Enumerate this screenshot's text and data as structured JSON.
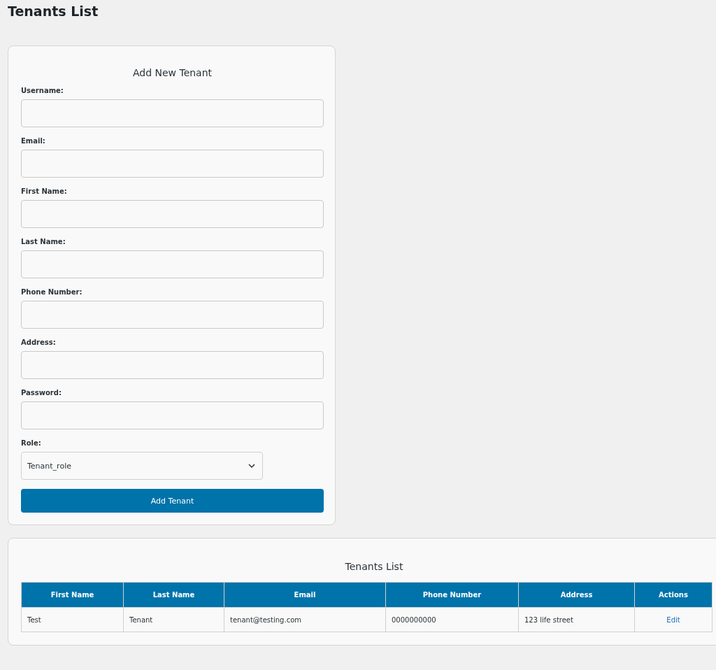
{
  "page_title": "Tenants List",
  "form": {
    "title": "Add New Tenant",
    "fields": [
      {
        "label": "Username:"
      },
      {
        "label": "Email:"
      },
      {
        "label": "First Name:"
      },
      {
        "label": "Last Name:"
      },
      {
        "label": "Phone Number:"
      },
      {
        "label": "Address:"
      },
      {
        "label": "Password:"
      }
    ],
    "role": {
      "label": "Role:",
      "value": "Tenant_role"
    },
    "submit": "Add Tenant"
  },
  "list": {
    "title": "Tenants List",
    "columns": [
      "First Name",
      "Last Name",
      "Email",
      "Phone Number",
      "Address",
      "Actions"
    ],
    "rows": [
      {
        "cells": [
          "Test",
          "Tenant",
          "tenant@testing.com",
          "0000000000",
          "123 life street"
        ],
        "action": "Edit"
      }
    ]
  }
}
